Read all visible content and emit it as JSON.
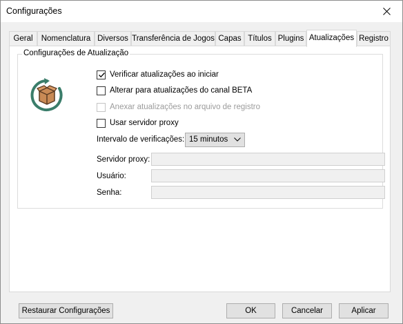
{
  "window": {
    "title": "Configurações"
  },
  "tabs": [
    {
      "label": "Geral",
      "active": false
    },
    {
      "label": "Nomenclatura",
      "active": false
    },
    {
      "label": "Diversos",
      "active": false
    },
    {
      "label": "Transferência de Jogos",
      "active": false
    },
    {
      "label": "Capas",
      "active": false
    },
    {
      "label": "Títulos",
      "active": false
    },
    {
      "label": "Plugins",
      "active": false
    },
    {
      "label": "Atualizações",
      "active": true
    },
    {
      "label": "Registro",
      "active": false
    }
  ],
  "update_settings": {
    "group_title": "Configurações de Atualização",
    "icon": "package-refresh-icon",
    "options": [
      {
        "label": "Verificar atualizações ao iniciar",
        "checked": true,
        "enabled": true
      },
      {
        "label": "Alterar para atualizações do canal BETA",
        "checked": false,
        "enabled": true
      },
      {
        "label": "Anexar atualizações no arquivo de registro",
        "checked": false,
        "enabled": false
      },
      {
        "label": "Usar servidor proxy",
        "checked": false,
        "enabled": true
      }
    ],
    "interval": {
      "label": "Intervalo de verificações:",
      "value": "15 minutos"
    },
    "proxy_server": {
      "label": "Servidor proxy:",
      "value": ""
    },
    "username": {
      "label": "Usuário:",
      "value": ""
    },
    "password": {
      "label": "Senha:",
      "value": ""
    }
  },
  "buttons": {
    "restore": "Restaurar Configurações",
    "ok": "OK",
    "cancel": "Cancelar",
    "apply": "Aplicar"
  },
  "colors": {
    "icon_ring": "#3a7d6a",
    "icon_box": "#c98a55",
    "window_bg": "#f0f0f0"
  }
}
